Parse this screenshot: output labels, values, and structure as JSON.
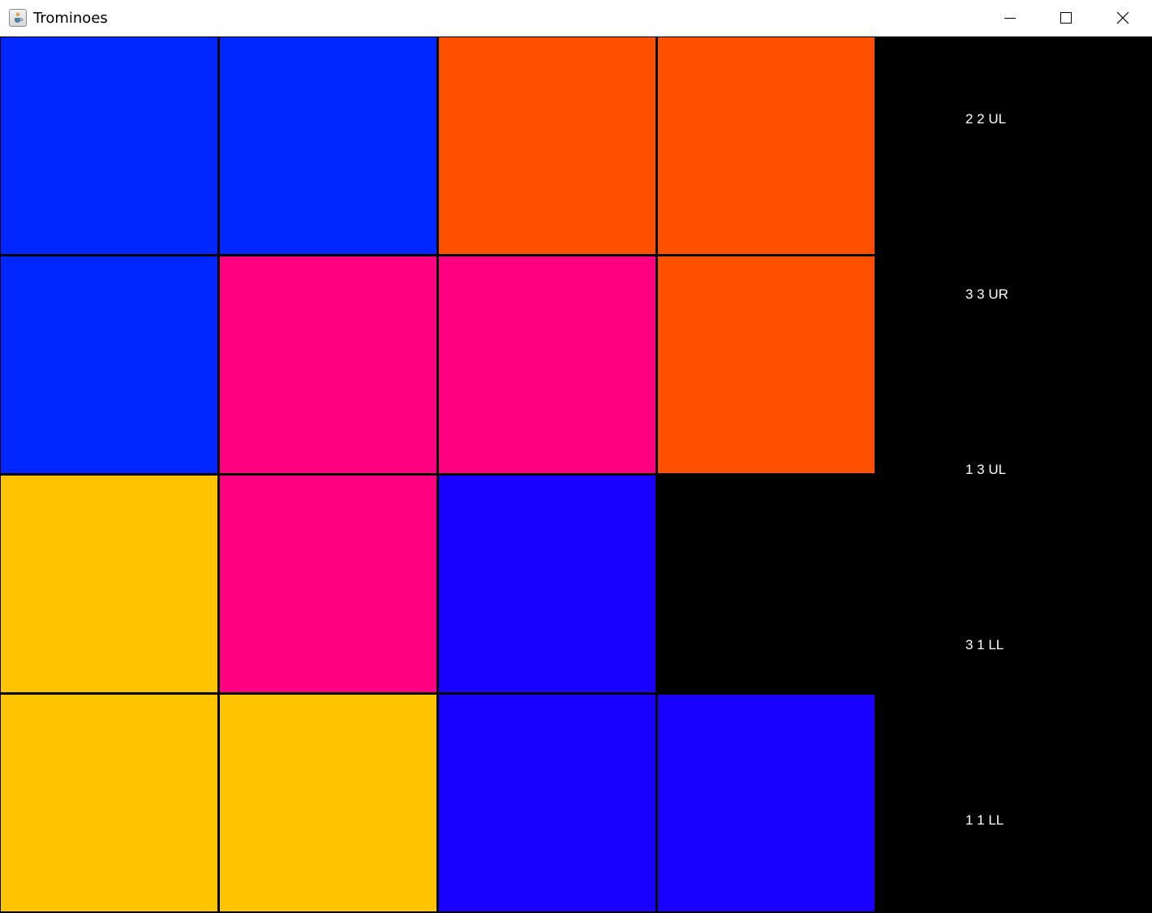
{
  "window": {
    "title": "Trominoes",
    "app_icon": "java-cup-icon",
    "controls": [
      "minimize-icon",
      "maximize-icon",
      "close-icon"
    ]
  },
  "board": {
    "rows": 4,
    "cols": 4,
    "cells": [
      [
        "#0026ff",
        "#0026ff",
        "#ff5000",
        "#ff5000"
      ],
      [
        "#0026ff",
        "#ff0080",
        "#ff0080",
        "#ff5000"
      ],
      [
        "#ffc400",
        "#ff0080",
        "#1a00ff",
        "#000000"
      ],
      [
        "#ffc400",
        "#ffc400",
        "#1a00ff",
        "#1a00ff"
      ]
    ]
  },
  "moves": [
    "2 2 UL",
    "3 3 UR",
    "1 3 UL",
    "3 1 LL",
    "1 1 LL"
  ],
  "colors": {
    "background": "#000000",
    "label_text": "#ffffff",
    "titlebar": "#ffffff"
  }
}
